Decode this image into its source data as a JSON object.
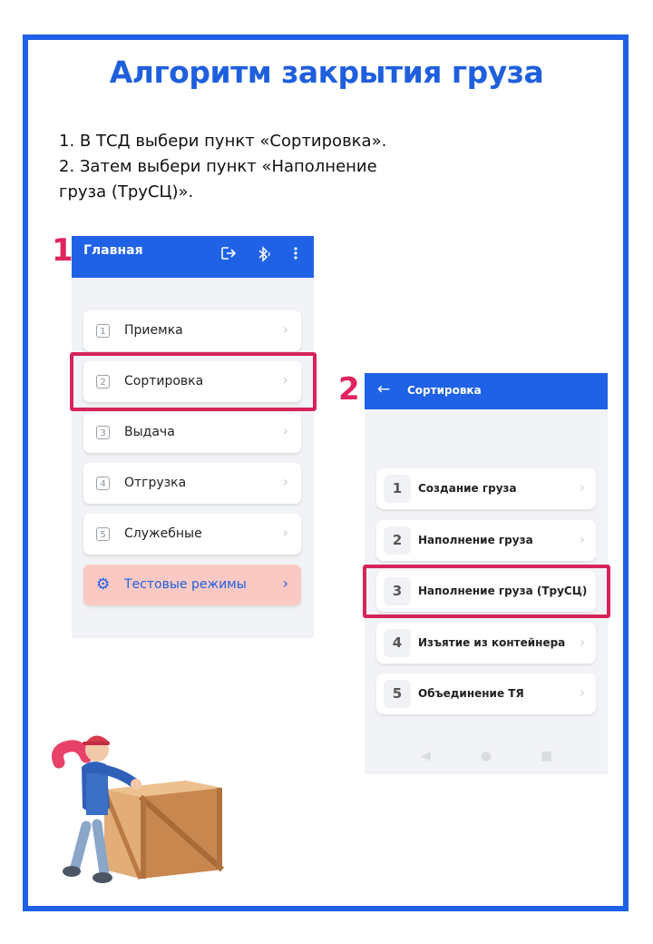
{
  "title": "Алгоритм закрытия груза",
  "instructions": [
    "1. В ТСД выбери пункт «Сортировка».",
    "2. Затем выбери пункт «Наполнение",
    "груза (ТруСЦ)»."
  ],
  "step_labels": [
    "1",
    "2"
  ],
  "screen1": {
    "header_title": "Главная",
    "header_icons": [
      "logout-icon",
      "bluetooth-icon",
      "more-vertical-icon"
    ],
    "items": [
      {
        "num": "1",
        "label": "Приемка"
      },
      {
        "num": "2",
        "label": "Сортировка"
      },
      {
        "num": "3",
        "label": "Выдача"
      },
      {
        "num": "4",
        "label": "Отгрузка"
      },
      {
        "num": "5",
        "label": "Служебные"
      }
    ],
    "test_item": {
      "label": "Тестовые режимы",
      "icon": "gear-icon"
    },
    "highlighted_item": "Сортировка"
  },
  "screen2": {
    "header_title": "Сортировка",
    "items": [
      {
        "num": "1",
        "label": "Создание груза"
      },
      {
        "num": "2",
        "label": "Наполнение груза"
      },
      {
        "num": "3",
        "label": "Наполнение груза (ТруСЦ)"
      },
      {
        "num": "4",
        "label": "Изъятие из контейнера"
      },
      {
        "num": "5",
        "label": "Объединение ТЯ"
      }
    ],
    "highlighted_item": "Наполнение груза (ТруСЦ)"
  },
  "colors": {
    "frame": "#1f62e6",
    "title": "#1f5fde",
    "app_bar": "#1f62e6",
    "highlight": "#d6245a",
    "test_item_bg": "#fbc9c4"
  }
}
